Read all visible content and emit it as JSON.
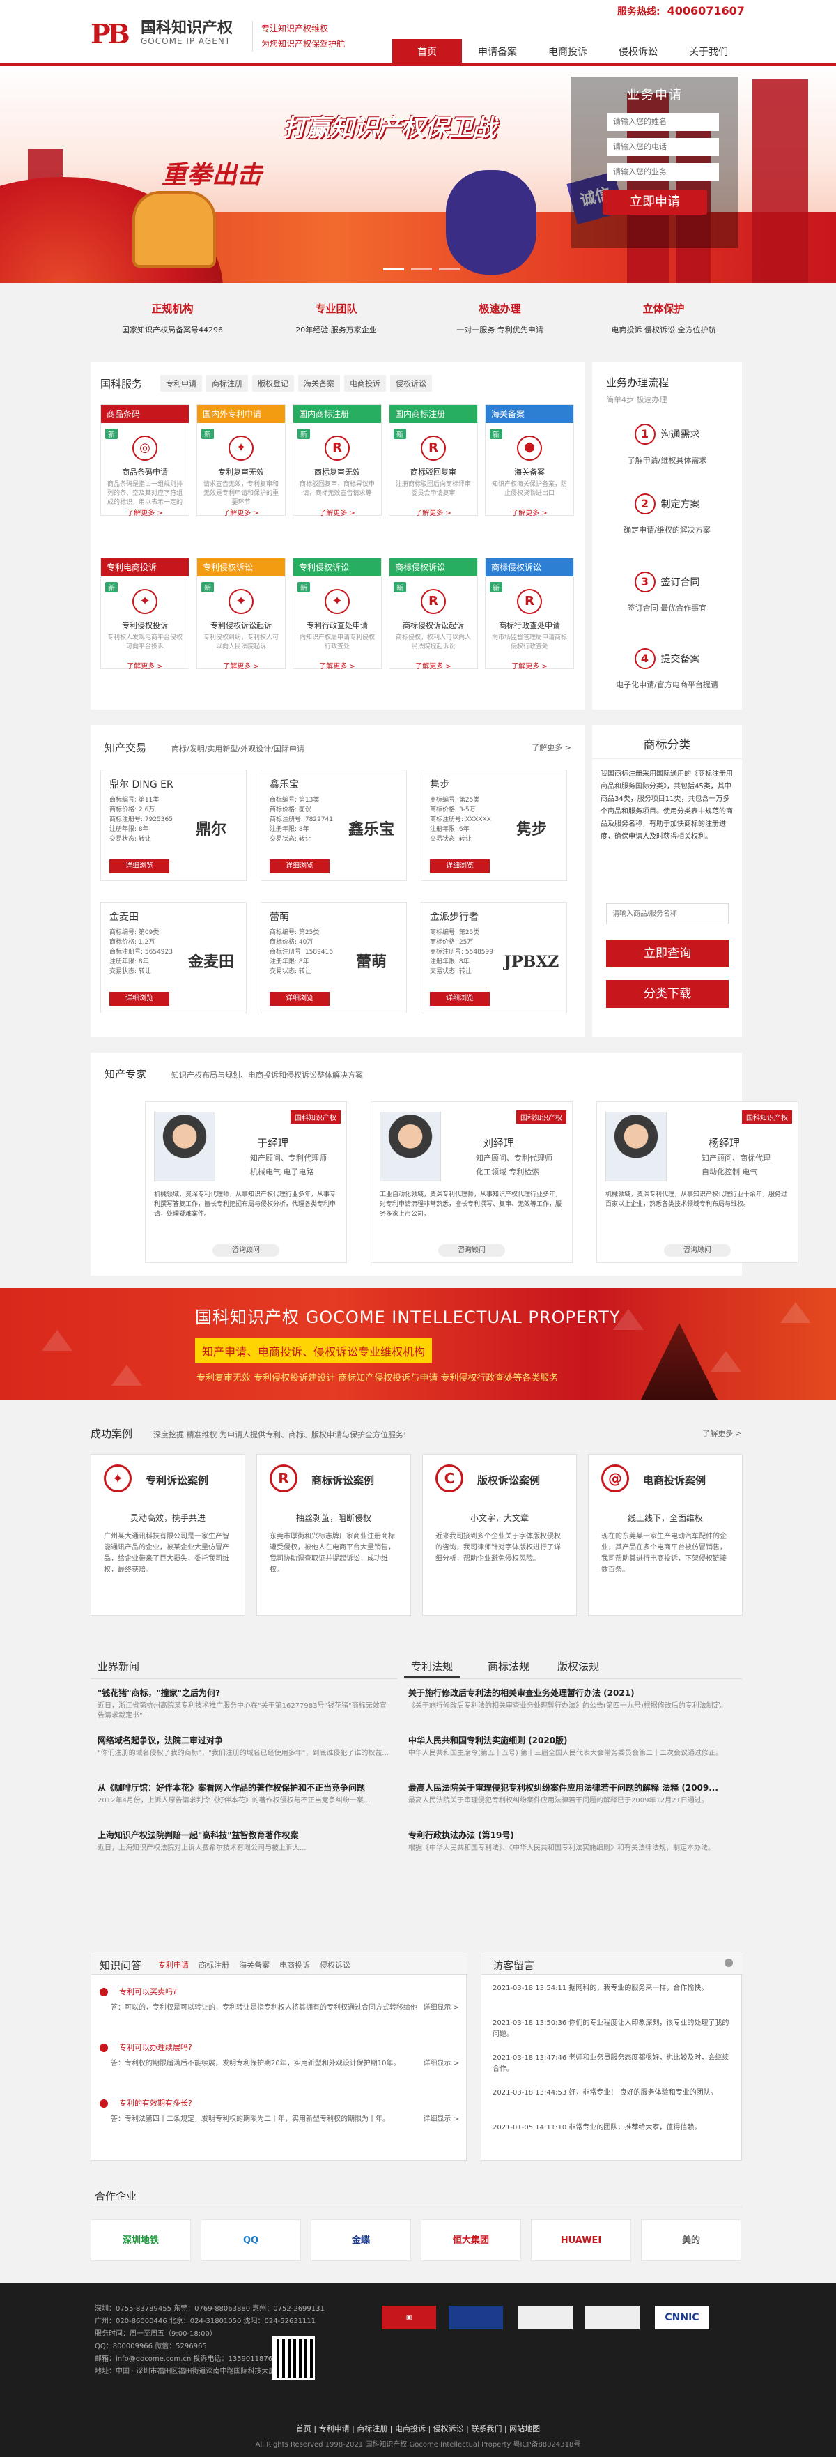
{
  "header": {
    "logo_cn": "国科知识产权",
    "logo_en": "GOCOME IP AGENT",
    "slogan1": "专注知识产权维权",
    "slogan2": "为您知识产权保驾护航",
    "hotline_label": "服务热线:",
    "hotline": "4006071607",
    "nav": [
      "首页",
      "申请备案",
      "电商投诉",
      "侵权诉讼",
      "关于我们"
    ]
  },
  "banner": {
    "title": "打赢知识产权保卫战",
    "subtitle": "重拳出击",
    "flag": "诚信",
    "apply_title": "业务申请",
    "ph_name": "请输入您的姓名",
    "ph_phone": "请输入您的电话",
    "ph_biz": "请输入您的业务",
    "apply_btn": "立即申请"
  },
  "features": [
    {
      "h": "正规机构",
      "d": "国家知识产权局备案号44296"
    },
    {
      "h": "专业团队",
      "d": "20年经验 服务万家企业"
    },
    {
      "h": "极速办理",
      "d": "一对一服务 专利优先申请"
    },
    {
      "h": "立体保护",
      "d": "电商投诉 侵权诉讼 全方位护航"
    }
  ],
  "services": {
    "title": "国科服务",
    "tabs": [
      "专利申请",
      "商标注册",
      "版权登记",
      "海关备案",
      "电商投诉",
      "侵权诉讼"
    ],
    "cards": [
      {
        "hd": "商品条码",
        "color": "#c8161d",
        "tag": "新",
        "ic": "◎",
        "nm": "商品条码申请",
        "ds": "商品条码是指由一组规则排列的条、空及其对应字符组成的标识，用以表示一定的商品信息的符号"
      },
      {
        "hd": "国内外专利申请",
        "color": "#f39c12",
        "tag": "新",
        "ic": "✦",
        "nm": "专利复审无效",
        "ds": "请求宣告无效，专利复审和无效是专利申请和保护的重要环节"
      },
      {
        "hd": "国内商标注册",
        "color": "#27ae60",
        "tag": "新",
        "ic": "R",
        "nm": "商标复审无效",
        "ds": "商标驳回复审，商标异议申请，商标无效宣告请求等"
      },
      {
        "hd": "国内商标注册",
        "color": "#27ae60",
        "tag": "新",
        "ic": "R",
        "nm": "商标驳回复审",
        "ds": "注册商标驳回后向商标评审委员会申请复审"
      },
      {
        "hd": "海关备案",
        "color": "#2d7fd3",
        "tag": "新",
        "ic": "⬢",
        "nm": "海关备案",
        "ds": "知识产权海关保护备案，防止侵权货物进出口"
      },
      {
        "hd": "专利电商投诉",
        "color": "#c8161d",
        "tag": "新",
        "ic": "✦",
        "nm": "专利侵权投诉",
        "ds": "专利权人发现电商平台侵权可向平台投诉"
      },
      {
        "hd": "专利侵权诉讼",
        "color": "#f39c12",
        "tag": "新",
        "ic": "✦",
        "nm": "专利侵权诉讼起诉",
        "ds": "专利侵权纠纷，专利权人可以向人民法院起诉"
      },
      {
        "hd": "专利侵权诉讼",
        "color": "#27ae60",
        "tag": "新",
        "ic": "✦",
        "nm": "专利行政查处申请",
        "ds": "向知识产权局申请专利侵权行政查处"
      },
      {
        "hd": "商标侵权诉讼",
        "color": "#27ae60",
        "tag": "新",
        "ic": "R",
        "nm": "商标侵权诉讼起诉",
        "ds": "商标侵权，权利人可以向人民法院提起诉讼"
      },
      {
        "hd": "商标侵权诉讼",
        "color": "#2d7fd3",
        "tag": "新",
        "ic": "R",
        "nm": "商标行政查处申请",
        "ds": "向市场监督管理局申请商标侵权行政查处"
      }
    ],
    "more": "了解更多 >"
  },
  "process": {
    "title": "业务办理流程",
    "sub": "简单4步 极速办理",
    "steps": [
      {
        "n": "1",
        "l": "沟通需求",
        "d": "了解申请/维权具体需求"
      },
      {
        "n": "2",
        "l": "制定方案",
        "d": "确定申请/维权的解决方案"
      },
      {
        "n": "3",
        "l": "签订合同",
        "d": "签订合同 最优合作事宜"
      },
      {
        "n": "4",
        "l": "提交备案",
        "d": "电子化申请/官方电商平台提请"
      }
    ]
  },
  "trade": {
    "title": "知产交易",
    "sub": "商标/发明/实用新型/外观设计/国际申请",
    "more": "了解更多 >",
    "btn": "详细浏览",
    "items": [
      {
        "nm": "鼎尔 DING ER",
        "k": [
          "商标编号: 第11类",
          "商标价格: 2.6万",
          "商标注册号: 7925365",
          "注册年限: 8年",
          "交易状态: 转让"
        ],
        "pic": "鼎尔"
      },
      {
        "nm": "鑫乐宝",
        "k": [
          "商标编号: 第13类",
          "商标价格: 面议",
          "商标注册号: 7822741",
          "注册年限: 8年",
          "交易状态: 转让"
        ],
        "pic": "鑫乐宝"
      },
      {
        "nm": "隽步",
        "k": [
          "商标编号: 第25类",
          "商标价格: 3-5万",
          "商标注册号: XXXXXX",
          "注册年限: 6年",
          "交易状态: 转让"
        ],
        "pic": "隽步"
      },
      {
        "nm": "金麦田",
        "k": [
          "商标编号: 第09类",
          "商标价格: 1.2万",
          "商标注册号: 5654923",
          "注册年限: 8年",
          "交易状态: 转让"
        ],
        "pic": "金麦田"
      },
      {
        "nm": "蕾萌",
        "k": [
          "商标编号: 第25类",
          "商标价格: 40万",
          "商标注册号: 1589416",
          "注册年限: 8年",
          "交易状态: 转让"
        ],
        "pic": "蕾萌"
      },
      {
        "nm": "金派步行者",
        "k": [
          "商标编号: 第25类",
          "商标价格: 25万",
          "商标注册号: 5548599",
          "注册年限: 8年",
          "交易状态: 转让"
        ],
        "pic": "JPBXZ"
      }
    ]
  },
  "classify": {
    "title": "商标分类",
    "text": "我国商标注册采用国际通用的《商标注册用商品和服务国际分类》，共包括45类，其中商品34类，服务项目11类，共包含一万多个商品和服务项目。使用分类表中规范的商品及服务名称，有助于加快商标的注册进度，确保申请人及时获得相关权利。",
    "ph": "请输入商品/服务名称",
    "btn1": "立即查询",
    "btn2": "分类下载"
  },
  "experts": {
    "title": "知产专家",
    "sub": "知识产权布局与规划、电商投诉和侵权诉讼整体解决方案",
    "logo": "国科知识产权",
    "btn": "咨询顾问",
    "items": [
      {
        "nm": "于经理",
        "r1": "知产顾问、专利代理师",
        "r2": "机械电气 电子电路",
        "bio": "机械领域，资深专利代理师，从事知识产权代理行业多年，从事专利撰写答复工作，擅长专利挖掘布局与侵权分析，代理各类专利申请，处理疑难案件。"
      },
      {
        "nm": "刘经理",
        "r1": "知产顾问、专利代理师",
        "r2": "化工领域 专利检索",
        "bio": "工业自动化领域，资深专利代理师，从事知识产权代理行业多年，对专利申请流程非常熟悉，擅长专利撰写、复审、无效等工作，服务多家上市公司。"
      },
      {
        "nm": "杨经理",
        "r1": "知产顾问、商标代理",
        "r2": "自动化控制 电气",
        "bio": "机械领域，资深专利代理，从事知识产权代理行业十余年，服务过百家以上企业，熟悉各类技术领域专利布局与维权。"
      }
    ]
  },
  "ipband": {
    "t1": "国科知识产权  GOCOME INTELLECTUAL PROPERTY",
    "t2": "知产申请、电商投诉、侵权诉讼专业维权机构",
    "t3": "专利复审无效  专利侵权投诉建设计  商标知产侵权投诉与申请  专利侵权行政查处等各类服务"
  },
  "cases": {
    "title": "成功案例",
    "sub": "深度挖掘 精准维权 为申请人提供专利、商标、版权申请与保护全方位服务!",
    "more": "了解更多 >",
    "items": [
      {
        "ic": "✦",
        "h": "专利诉讼案例",
        "s": "灵动高效，携手共进",
        "d": "广州某大通讯科技有限公司是一家生产智能通讯产品的企业，被某企业大量仿冒产品，给企业带来了巨大损失，委托我司维权，最终获赔。"
      },
      {
        "ic": "R",
        "h": "商标诉讼案例",
        "s": "抽丝剥茧，阻断侵权",
        "d": "东莞市厚街和兴标志牌厂家商业注册商标遭受侵权，被他人在电商平台大量销售，我司协助调查取证并提起诉讼，成功维权。"
      },
      {
        "ic": "C",
        "h": "版权诉讼案例",
        "s": "小文字，大文章",
        "d": "近来我司接到多个企业关于字体版权侵权的咨询，我司律师针对字体版权进行了详细分析，帮助企业避免侵权风险。"
      },
      {
        "ic": "@",
        "h": "电商投诉案例",
        "s": "线上线下，全面维权",
        "d": "现在的东莞某一家生产电动汽车配件的企业，其产品在多个电商平台被仿冒销售，我司帮助其进行电商投诉，下架侵权链接数百条。"
      }
    ]
  },
  "news": {
    "title": "业界新闻",
    "items": [
      {
        "t": "\"钱花猪\"商标，\"撞家\"之后为何?",
        "d": "近日，浙江省第杭州高院某专利技术推广服务中心在\"关于第16277983号\"钱花猪\"商标无效宣告请求裁定书\"..."
      },
      {
        "t": "网络域名起争议，法院二审过对争",
        "d": "\"你们注册的域名侵权了我的商标\"，\"我们注册的域名已经使用多年\"，到底谁侵犯了谁的权益..."
      },
      {
        "t": "从《咖啡厅馆：好伴本花》案看网入作品的著作权保护和不正当竞争问题",
        "d": "2012年4月份，上诉人原告请求判令《好伴本花》的著作权侵权与不正当竞争纠纷一案..."
      },
      {
        "t": "上海知识产权法院判赔一起\"高科技\"益智教育著作权案",
        "d": "近日，上海知识产权法院对上诉人费希尔技术有限公司与被上诉人..."
      }
    ]
  },
  "law": {
    "tabs": [
      "专利法规",
      "商标法规",
      "版权法规"
    ],
    "items": [
      {
        "t": "关于施行修改后专利法的相关审查业务处理暂行办法 (2021)",
        "d": "《关于施行修改后专利法的相关审查业务处理暂行办法》的公告(第四一九号)根据修改后的专利法制定。"
      },
      {
        "t": "中华人民共和国专利法实施细则 (2020版)",
        "d": "中华人民共和国主席令(第五十五号) 第十三届全国人民代表大会常务委员会第二十二次会议通过修正。"
      },
      {
        "t": "最高人民法院关于审理侵犯专利权纠纷案件应用法律若干问题的解释 法释 (2009...",
        "d": "最高人民法院关于审理侵犯专利权纠纷案件应用法律若干问题的解释已于2009年12月21日通过。"
      },
      {
        "t": "专利行政执法办法 (第19号)",
        "d": "根据《中华人民共和国专利法》、《中华人民共和国专利法实施细则》和有关法律法规，制定本办法。"
      }
    ]
  },
  "qa": {
    "title": "知识问答",
    "tabs": [
      "专利申请",
      "商标注册",
      "海关备案",
      "电商投诉",
      "侵权诉讼"
    ],
    "more": "详细显示 >",
    "items": [
      {
        "q": "专利可以买卖吗?",
        "a": "答：可以的，专利权是可以转让的，专利转让是指专利权人将其拥有的专利权通过合同方式转移给他人。"
      },
      {
        "q": "专利可以办理续展吗?",
        "a": "答：专利权的期限届满后不能续展，发明专利保护期20年，实用新型和外观设计保护期10年。"
      },
      {
        "q": "专利的有效期有多长?",
        "a": "答：专利法第四十二条规定，发明专利权的期限为二十年，实用新型专利权的期限为十年。"
      }
    ]
  },
  "guest": {
    "title": "访客留言",
    "items": [
      {
        "t": "2021-03-18 13:54:11 据网科的，我专业的服务来一样，合作愉快。"
      },
      {
        "t": "2021-03-18 13:50:36 你们的专业程度让人印象深刻，很专业的处理了我的问题。"
      },
      {
        "t": "2021-03-18 13:47:46 老师和业务员服务态度都很好，也比较及时，会继续合作。"
      },
      {
        "t": "2021-03-18 13:44:53 好，非常专业！ 良好的服务体验和专业的团队。"
      },
      {
        "t": "2021-01-05 14:11:10 非常专业的团队，推荐给大家，值得信赖。"
      }
    ]
  },
  "partners": {
    "title": "合作企业",
    "items": [
      "深圳地铁",
      "QQ",
      "金蝶",
      "恒大集团",
      "HUAWEI",
      "美的"
    ]
  },
  "footer": {
    "lines": [
      "深圳：0755-83789455    东莞：0769-88063880    惠州：0752-2699131",
      "广州：020-86000446    北京：024-31801050    沈阳：024-52631111",
      "服务时间：周一至周五（9:00-18:00）",
      "QQ：800009966 微信：5296965",
      "邮箱：info@gocome.com.cn 投诉电话：13590118768",
      "地址：中国 · 深圳市福田区福田街道深南中路国际科技大厦2503室"
    ],
    "nav": "首页 | 专利申请 | 商标注册 | 电商投诉 | 侵权诉讼 | 联系我们 | 网站地图",
    "copy": "All Rights Reserved 1998-2021 国科知识产权 Gocome Intellectual Property 粤ICP备88024318号"
  },
  "colors": {
    "brand": "#c8161d",
    "accent_yellow": "#ffd400"
  }
}
